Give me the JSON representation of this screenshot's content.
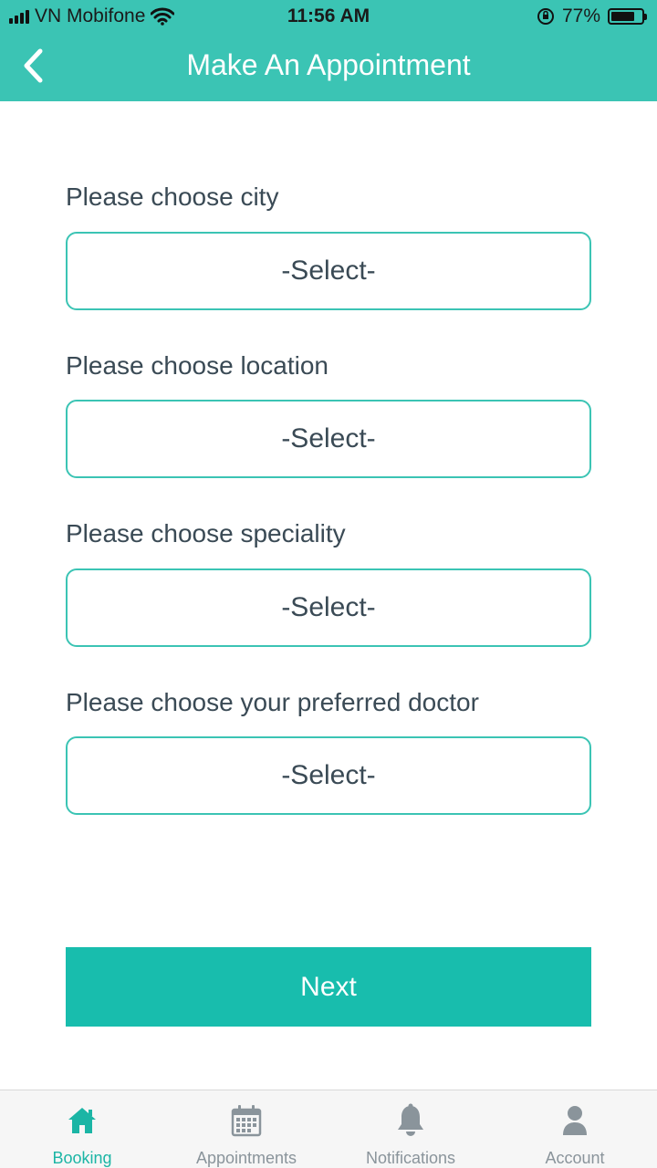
{
  "status_bar": {
    "carrier": "VN Mobifone",
    "time": "11:56 AM",
    "battery": "77%"
  },
  "header": {
    "title": "Make An Appointment"
  },
  "form": {
    "fields": [
      {
        "label": "Please choose city",
        "value": "-Select-"
      },
      {
        "label": "Please choose location",
        "value": "-Select-"
      },
      {
        "label": "Please choose speciality",
        "value": "-Select-"
      },
      {
        "label": "Please choose your preferred doctor",
        "value": "-Select-"
      }
    ],
    "next_label": "Next"
  },
  "tabs": [
    {
      "label": "Booking",
      "icon": "home-icon",
      "active": true
    },
    {
      "label": "Appointments",
      "icon": "calendar-icon",
      "active": false
    },
    {
      "label": "Notifications",
      "icon": "bell-icon",
      "active": false
    },
    {
      "label": "Account",
      "icon": "user-icon",
      "active": false
    }
  ],
  "colors": {
    "accent": "#3bc4b4",
    "button": "#18bdad",
    "active_tab": "#1bb5a5",
    "inactive_tab": "#8a949b"
  }
}
